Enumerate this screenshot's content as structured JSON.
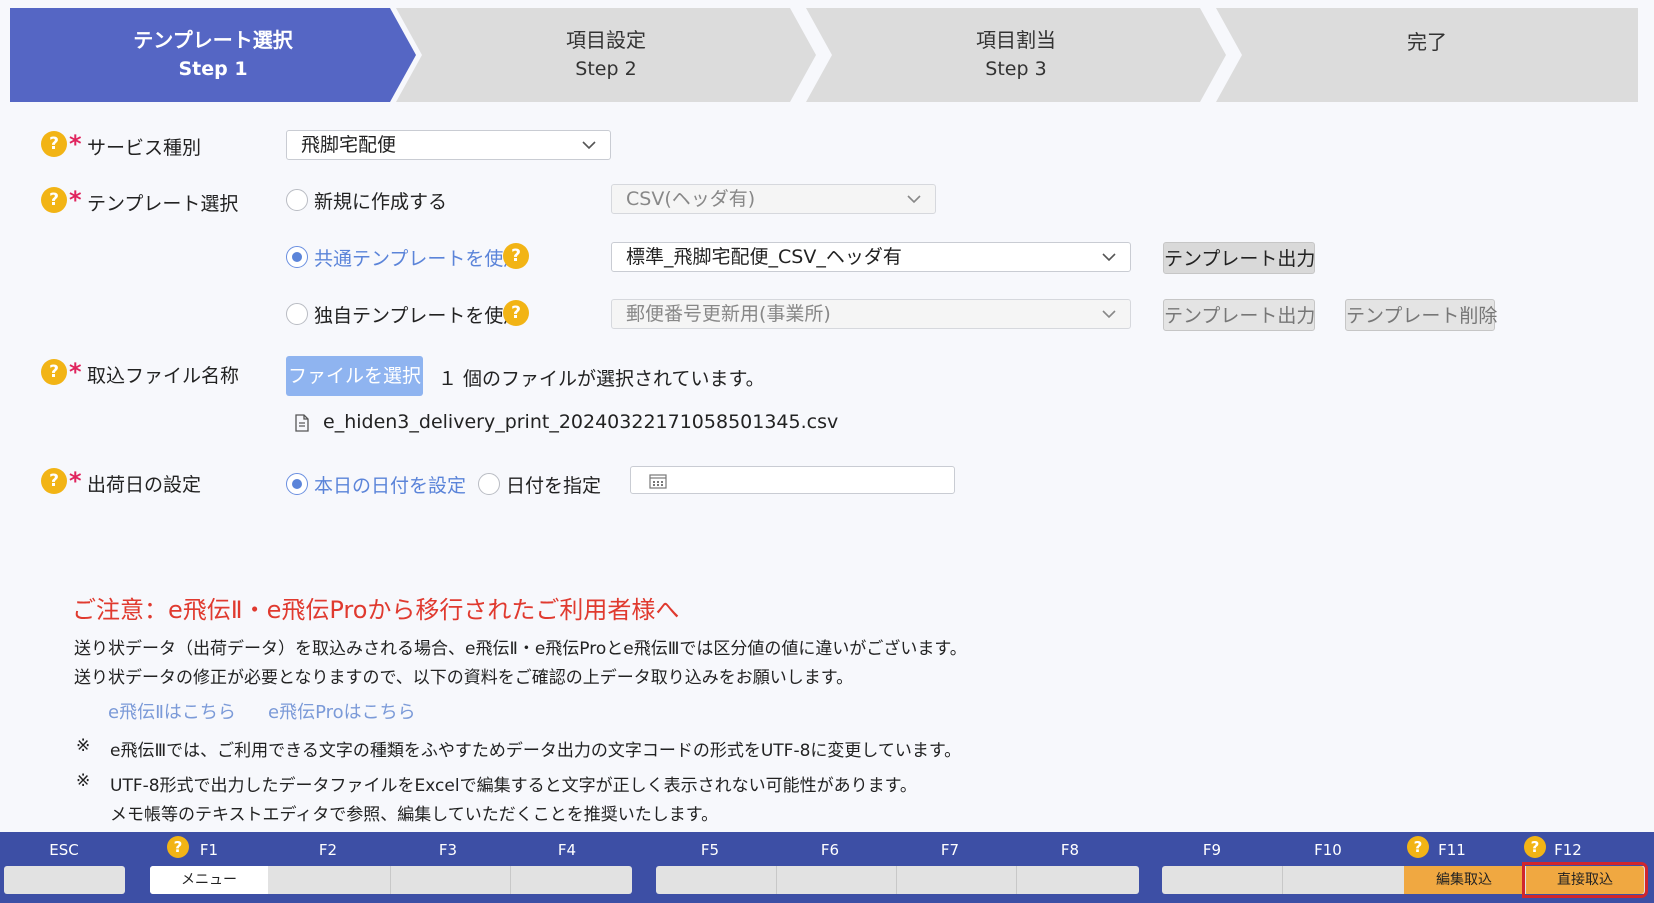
{
  "steps": [
    {
      "title": "テンプレート選択",
      "sub": "Step 1"
    },
    {
      "title": "項目設定",
      "sub": "Step 2"
    },
    {
      "title": "項目割当",
      "sub": "Step 3"
    },
    {
      "title": "完了",
      "sub": ""
    }
  ],
  "colors": {
    "step_active": "#5566c4",
    "step_inactive": "#dcdcdc",
    "accent": "#5b84d9",
    "help": "#f2b415",
    "required": "#e0245e",
    "notice": "#e03a2f",
    "fbar": "#3d4fa5",
    "fkey_orange": "#f0a841",
    "highlight": "#d0262d"
  },
  "form": {
    "service": {
      "label": "サービス種別",
      "value": "飛脚宅配便"
    },
    "template": {
      "label": "テンプレート選択",
      "opt_new": "新規に作成する",
      "new_select": "CSV(ヘッダ有)",
      "opt_common": "共通テンプレートを使用",
      "common_select": "標準_飛脚宅配便_CSV_ヘッダ有",
      "common_export": "テンプレート出力",
      "opt_own": "独自テンプレートを使用",
      "own_select": "郵便番号更新用(事業所)",
      "own_export": "テンプレート出力",
      "own_delete": "テンプレート削除"
    },
    "file": {
      "label": "取込ファイル名称",
      "button": "ファイルを選択",
      "status": "１ 個のファイルが選択されています。",
      "filename": "e_hiden3_delivery_print_20240322171058501345.csv"
    },
    "ship_date": {
      "label": "出荷日の設定",
      "opt_today": "本日の日付を設定",
      "opt_specify": "日付を指定",
      "date_value": ""
    }
  },
  "notice": {
    "title": "ご注意：e飛伝Ⅱ・e飛伝Proから移行されたご利用者様へ",
    "line1": "送り状データ（出荷データ）を取込みされる場合、e飛伝Ⅱ・e飛伝Proとe飛伝Ⅲでは区分値の値に違いがございます。",
    "line2": "送り状データの修正が必要となりますので、以下の資料をご確認の上データ取り込みをお願いします。",
    "link1": "e飛伝Ⅱはこちら",
    "link2": "e飛伝Proはこちら",
    "mark": "※",
    "note1": "e飛伝Ⅲでは、ご利用できる文字の種類をふやすためデータ出力の文字コードの形式をUTF-8に変更しています。",
    "note2a": "UTF-8形式で出力したデータファイルをExcelで編集すると文字が正しく表示されない可能性があります。",
    "note2b": "メモ帳等のテキストエディタで参照、編集していただくことを推奨いたします。"
  },
  "fkeys": {
    "esc": "ESC",
    "f1": "F1",
    "f2": "F2",
    "f3": "F3",
    "f4": "F4",
    "f5": "F5",
    "f6": "F6",
    "f7": "F7",
    "f8": "F8",
    "f9": "F9",
    "f10": "F10",
    "f11": "F11",
    "f12": "F12",
    "f1_label": "メニュー",
    "f11_label": "編集取込",
    "f12_label": "直接取込"
  },
  "help_mark": "?",
  "required_mark": "*"
}
